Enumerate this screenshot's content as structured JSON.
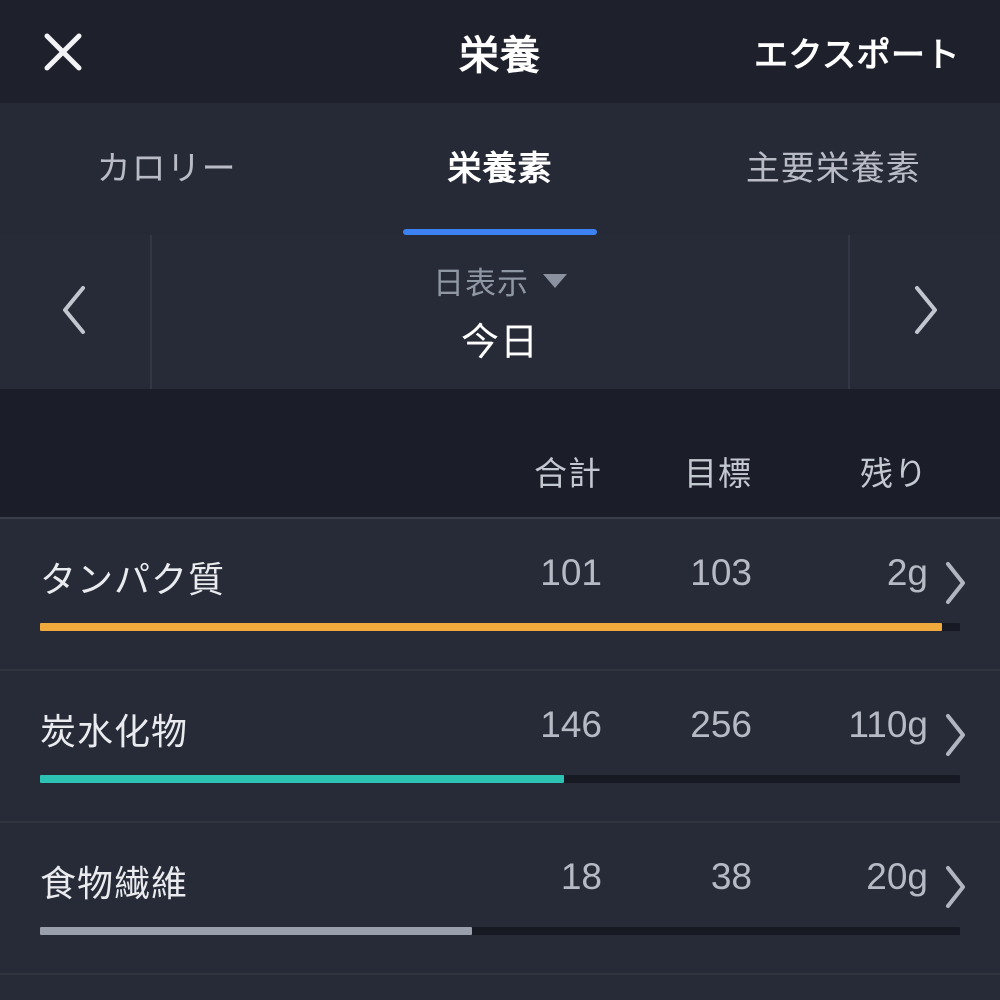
{
  "header": {
    "close_icon": "close-icon",
    "title": "栄養",
    "export_label": "エクスポート"
  },
  "tabs": [
    {
      "label": "カロリー",
      "active": false
    },
    {
      "label": "栄養素",
      "active": true
    },
    {
      "label": "主要栄養素",
      "active": false
    }
  ],
  "date_nav": {
    "prev_icon": "chevron-left-icon",
    "next_icon": "chevron-right-icon",
    "mode_label": "日表示",
    "mode_caret_icon": "caret-down-icon",
    "value": "今日"
  },
  "table": {
    "columns": [
      "合計",
      "目標",
      "残り"
    ],
    "rows": [
      {
        "name": "タンパク質",
        "total": "101",
        "goal": "103",
        "remaining": "2g",
        "progress_pct": 98,
        "bar_color": "#f0a93c",
        "chevron_icon": "chevron-right-icon"
      },
      {
        "name": "炭水化物",
        "total": "146",
        "goal": "256",
        "remaining": "110g",
        "progress_pct": 57,
        "bar_color": "#2cc3b4",
        "chevron_icon": "chevron-right-icon"
      },
      {
        "name": "食物繊維",
        "total": "18",
        "goal": "38",
        "remaining": "20g",
        "progress_pct": 47,
        "bar_color": "#9aa0ab",
        "chevron_icon": "chevron-right-icon"
      }
    ]
  },
  "colors": {
    "accent": "#3d82f2",
    "header_bg": "#1e212c",
    "body_bg": "#262a36",
    "row_bg": "#272b37",
    "column_header_bg": "#1b1e28",
    "protein": "#f0a93c",
    "carbs": "#2cc3b4",
    "fiber": "#9aa0ab"
  }
}
